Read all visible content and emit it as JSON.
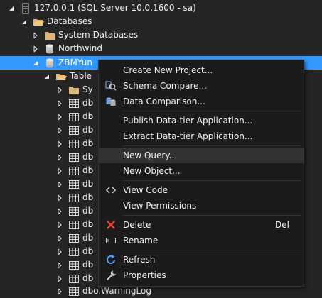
{
  "tree": {
    "server": "127.0.0.1 (SQL Server 10.0.1600 - sa)",
    "databases": "Databases",
    "system_databases": "System Databases",
    "northwind": "Northwind",
    "zbm": "ZBMYun",
    "tables": "Table",
    "system_tables": "Sy",
    "table_stub": "db",
    "last_table": "dbo.WarningLog"
  },
  "context_menu": {
    "create_project": "Create New Project...",
    "schema_compare": "Schema Compare...",
    "data_comparison": "Data Comparison...",
    "publish": "Publish Data-tier Application...",
    "extract": "Extract Data-tier Application...",
    "new_query": "New Query...",
    "new_object": "New Object...",
    "view_code": "View Code",
    "view_permissions": "View Permissions",
    "delete": "Delete",
    "delete_shortcut": "Del",
    "rename": "Rename",
    "refresh": "Refresh",
    "properties": "Properties"
  },
  "colors": {
    "background": "#252526",
    "selection": "#3399ff",
    "menu_background": "#1b1b1c",
    "menu_hover": "#333334",
    "delete_icon": "#e8432c",
    "refresh_icon": "#4aa3ff"
  }
}
